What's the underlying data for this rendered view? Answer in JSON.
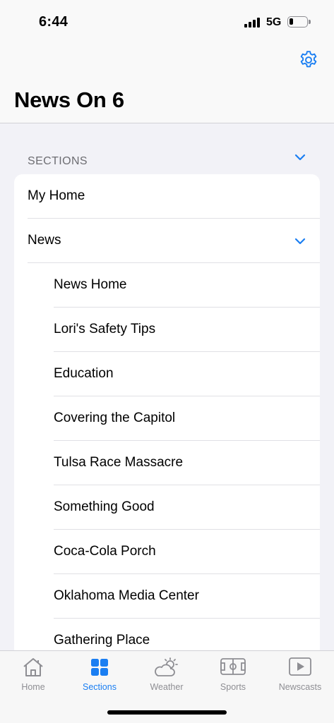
{
  "status_bar": {
    "time": "6:44",
    "network": "5G"
  },
  "header": {
    "title": "News On 6",
    "settings_icon": "gear-icon"
  },
  "sections": {
    "header": "SECTIONS",
    "items": [
      {
        "label": "My Home"
      },
      {
        "label": "News",
        "expanded": true
      },
      {
        "label": "News Home",
        "indent": true
      },
      {
        "label": "Lori's Safety Tips",
        "indent": true
      },
      {
        "label": "Education",
        "indent": true
      },
      {
        "label": "Covering the Capitol",
        "indent": true
      },
      {
        "label": "Tulsa Race Massacre",
        "indent": true
      },
      {
        "label": "Something Good",
        "indent": true
      },
      {
        "label": "Coca-Cola Porch",
        "indent": true
      },
      {
        "label": "Oklahoma Media Center",
        "indent": true
      },
      {
        "label": "Gathering Place",
        "indent": true
      }
    ]
  },
  "tab_bar": {
    "tabs": [
      {
        "label": "Home",
        "icon": "house-icon"
      },
      {
        "label": "Sections",
        "icon": "grid-icon",
        "active": true
      },
      {
        "label": "Weather",
        "icon": "partly-cloudy-icon"
      },
      {
        "label": "Sports",
        "icon": "field-icon"
      },
      {
        "label": "Newscasts",
        "icon": "play-icon"
      }
    ]
  },
  "colors": {
    "accent": "#1a7ef2",
    "inactive": "#8e8e93",
    "background": "#f2f2f7"
  }
}
